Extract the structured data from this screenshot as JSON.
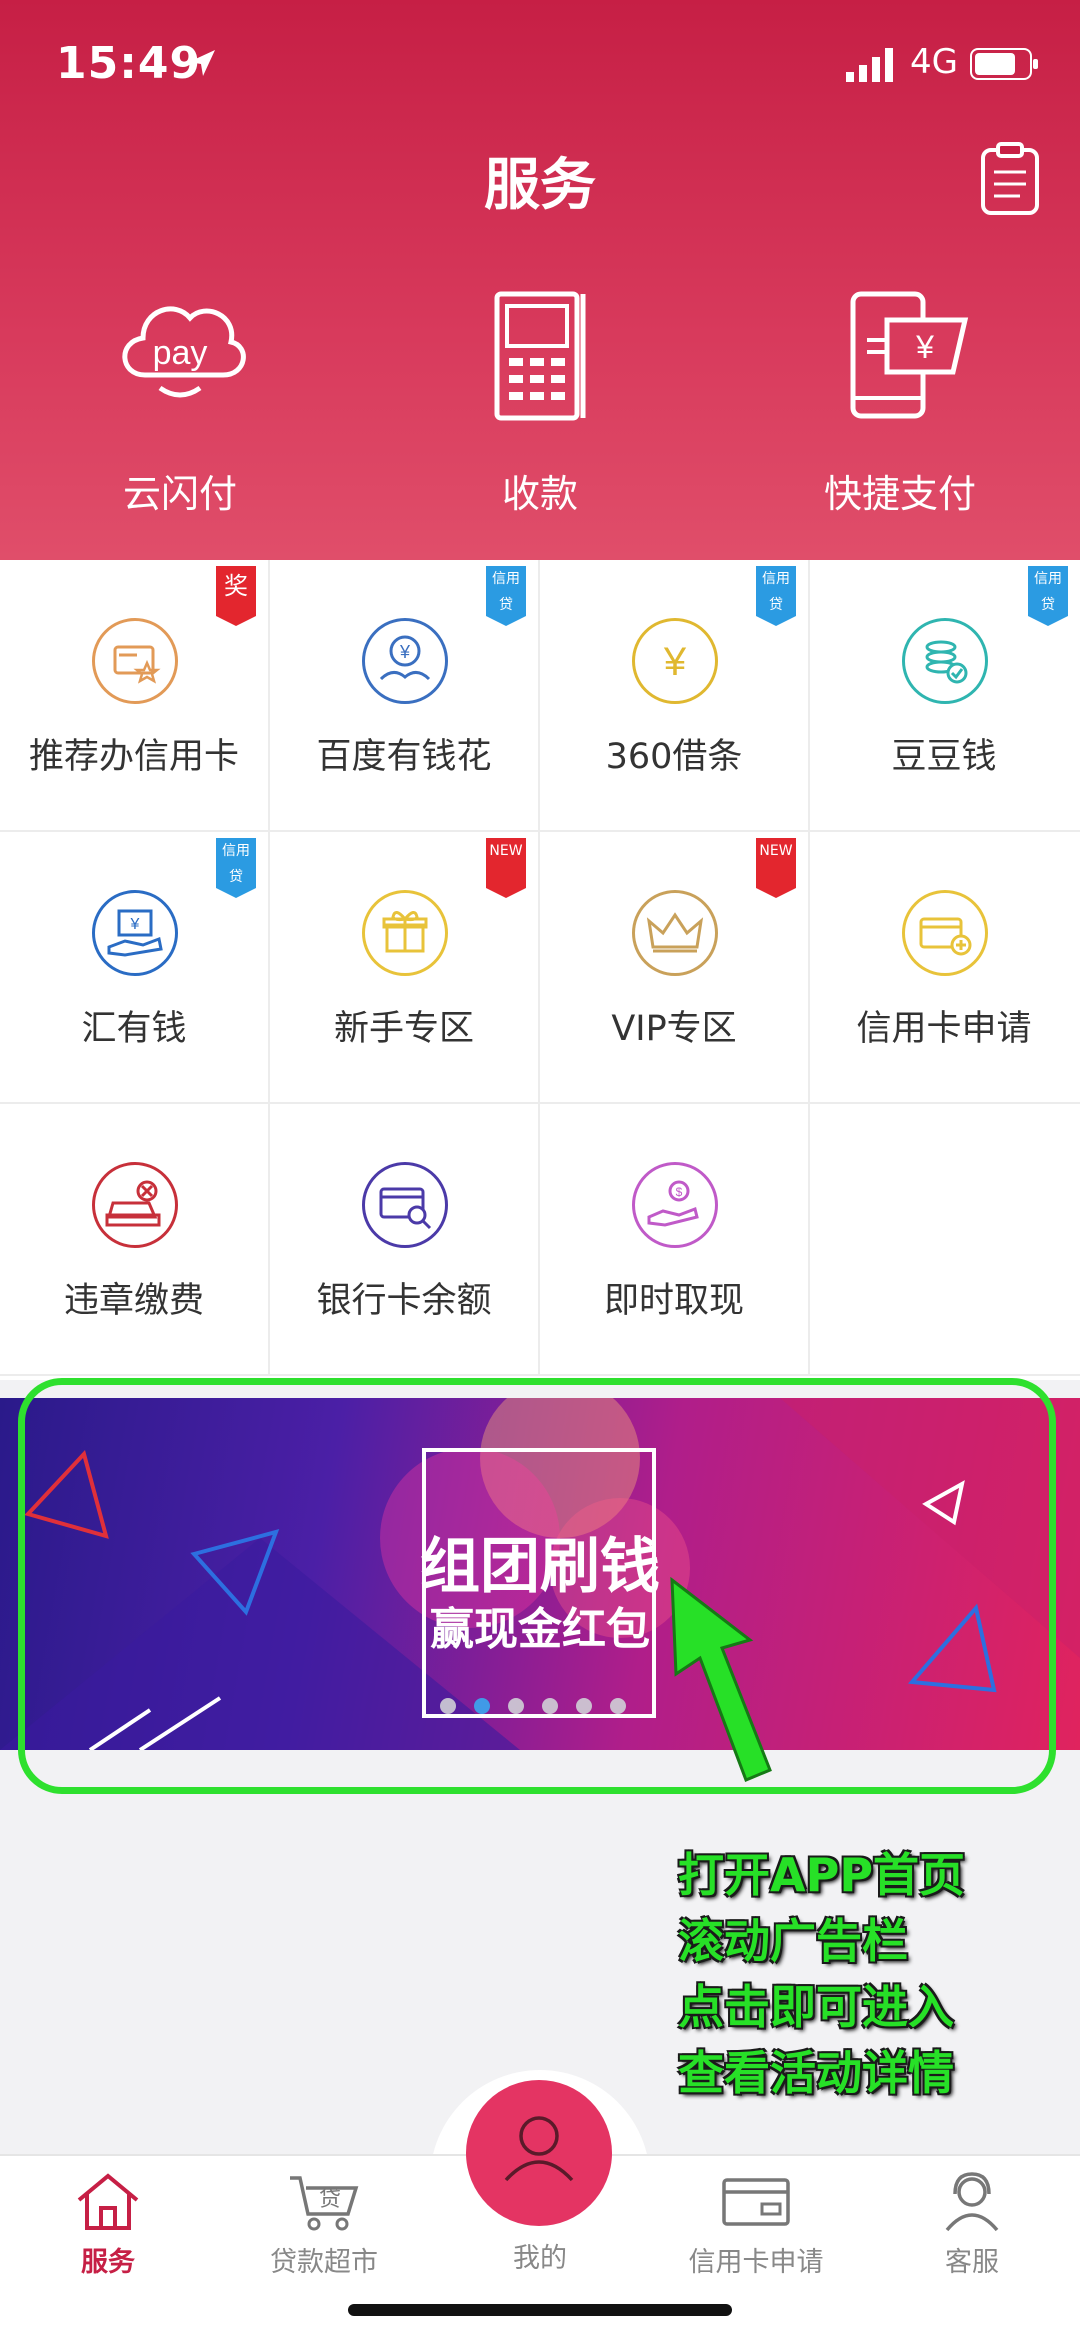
{
  "status": {
    "time": "15:49",
    "network": "4G"
  },
  "header": {
    "title": "服务"
  },
  "quick_actions": [
    {
      "label": "云闪付",
      "icon": "pay-cloud-icon"
    },
    {
      "label": "收款",
      "icon": "pos-terminal-icon"
    },
    {
      "label": "快捷支付",
      "icon": "phone-yuan-card-icon"
    }
  ],
  "services": [
    {
      "label": "推荐办信用卡",
      "tag": "奖",
      "color": "#e29a57"
    },
    {
      "label": "百度有钱花",
      "tag": "信用贷",
      "color": "#3a6fc0"
    },
    {
      "label": "360借条",
      "tag": "信用贷",
      "color": "#e0b830"
    },
    {
      "label": "豆豆钱",
      "tag": "信用贷",
      "color": "#2fb5b0"
    },
    {
      "label": "汇有钱",
      "tag": "信用贷",
      "color": "#2a6cc4"
    },
    {
      "label": "新手专区",
      "tag": "NEW",
      "color": "#e8c33a"
    },
    {
      "label": "VIP专区",
      "tag": "NEW",
      "color": "#c9a15a"
    },
    {
      "label": "信用卡申请",
      "tag": "",
      "color": "#e8c33a"
    },
    {
      "label": "违章缴费",
      "tag": "",
      "color": "#c7303a"
    },
    {
      "label": "银行卡余额",
      "tag": "",
      "color": "#4b3aa8"
    },
    {
      "label": "即时取现",
      "tag": "",
      "color": "#c05ac8"
    }
  ],
  "banner": {
    "line1": "组团刷钱",
    "line2": "赢现金红包",
    "dots_total": 6,
    "active_dot": 2
  },
  "annotation": {
    "lines": [
      "打开APP首页",
      "滚动广告栏",
      "点击即可进入",
      "查看活动详情"
    ]
  },
  "tabbar": {
    "tabs": [
      {
        "label": "服务",
        "icon": "home-icon",
        "active": true
      },
      {
        "label": "贷款超市",
        "icon": "loan-cart-icon",
        "active": false
      },
      {
        "label": "我的",
        "icon": "user-icon",
        "active": false
      },
      {
        "label": "信用卡申请",
        "icon": "credit-card-icon",
        "active": false
      },
      {
        "label": "客服",
        "icon": "customer-service-icon",
        "active": false
      }
    ]
  }
}
